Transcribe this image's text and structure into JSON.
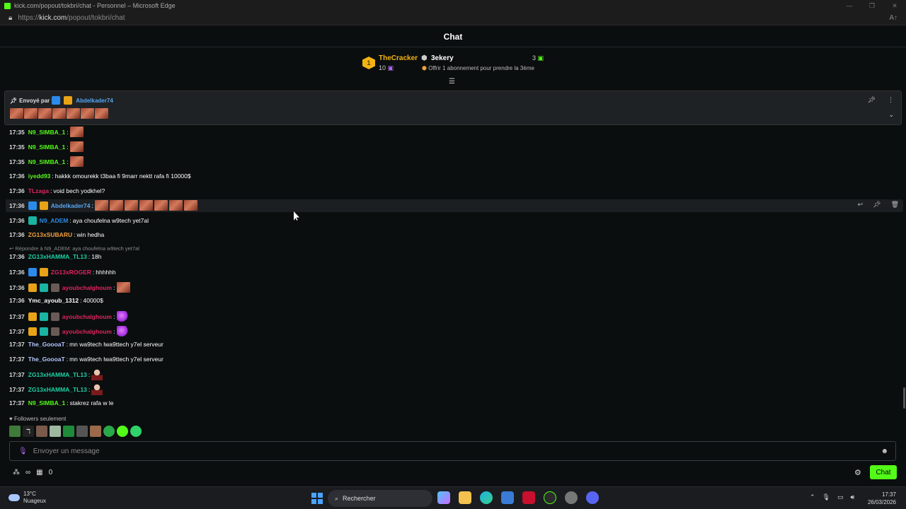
{
  "window": {
    "title": "kick.com/popout/tokbri/chat - Personnel – Microsoft Edge",
    "url_prefix": "https://",
    "url_host": "kick.com",
    "url_path": "/popout/tokbri/chat"
  },
  "header": {
    "title": "Chat"
  },
  "leaderboard": {
    "first": {
      "rank": "1",
      "name": "TheCracker",
      "count": "10"
    },
    "second": {
      "name": "3ekery",
      "count": "3"
    },
    "offer_text": "Offrir 1 abonnement pour prendre la 3ème"
  },
  "pinned": {
    "label": "Envoyé par",
    "user": "Abdelkader74",
    "emote_count": 7
  },
  "messages": [
    {
      "time": "17:35",
      "user": "N9_SIMBA_1",
      "color": "#53fc18",
      "text": "",
      "emotes": 1
    },
    {
      "time": "17:35",
      "user": "N9_SIMBA_1",
      "color": "#53fc18",
      "text": "",
      "emotes": 1
    },
    {
      "time": "17:35",
      "user": "N9_SIMBA_1",
      "color": "#53fc18",
      "text": "",
      "emotes": 1
    },
    {
      "time": "17:36",
      "user": "iyedd93",
      "color": "#53fc18",
      "text": "hakkk omourekk t3baa fi 9marr nektt rafa fi 10000$"
    },
    {
      "time": "17:36",
      "user": "TLzaga",
      "color": "#e0245e",
      "text": "void bech yodkhel?"
    },
    {
      "time": "17:36",
      "user": "Abdelkader74",
      "color": "#58a6f0",
      "text": "",
      "emotes": 7
    },
    {
      "time": "17:36",
      "user": "N9_ADEM",
      "color": "#2c8bea",
      "text": "aya choufelna w9tech yet7al"
    },
    {
      "time": "17:36",
      "user": "ZG13xSUBARU",
      "color": "#f2a03c",
      "text": "win hedha"
    },
    {
      "time": "17:36",
      "user": "ZG13xHAMMA_TL13",
      "color": "#1bd1a5",
      "text": "18h"
    },
    {
      "time": "17:36",
      "user": "ZG13xROGER",
      "color": "#e0245e",
      "text": "hhhhhh"
    },
    {
      "time": "17:36",
      "user": "ayoubchalghoum",
      "color": "#e0245e",
      "text": ""
    },
    {
      "time": "17:36",
      "user": "Ymc_ayoub_1312",
      "color": "#ffffff",
      "text": "40000$"
    },
    {
      "time": "17:37",
      "user": "ayoubchalghoum",
      "color": "#e0245e",
      "text": ""
    },
    {
      "time": "17:37",
      "user": "ayoubchalghoum",
      "color": "#e0245e",
      "text": ""
    },
    {
      "time": "17:37",
      "user": "The_GoooaT",
      "color": "#b4c7ff",
      "text": "mn wa9tech lwa9ttech y7el serveur"
    },
    {
      "time": "17:37",
      "user": "The_GoooaT",
      "color": "#b4c7ff",
      "text": "mn wa9tech lwa9ttech y7el serveur"
    },
    {
      "time": "17:37",
      "user": "ZG13xHAMMA_TL13",
      "color": "#1bd1a5",
      "text": ""
    },
    {
      "time": "17:37",
      "user": "ZG13xHAMMA_TL13",
      "color": "#1bd1a5",
      "text": ""
    },
    {
      "time": "17:37",
      "user": "N9_SIMBA_1",
      "color": "#53fc18",
      "text": "stakrez rafa w le"
    }
  ],
  "reply_hint": "Répondre à N9_ADEM: aya choufelna w9tech yet7al",
  "followers_label": "Followers seulement",
  "input": {
    "placeholder": "Envoyer un message"
  },
  "bottom": {
    "count": "0",
    "chat_button": "Chat"
  },
  "taskbar": {
    "temp": "13°C",
    "weather": "Nuageux",
    "search": "Rechercher",
    "time": "17:37",
    "date": "26/03/2026"
  },
  "colors": {
    "accent": "#53fc18",
    "background": "#0b0e0f"
  }
}
